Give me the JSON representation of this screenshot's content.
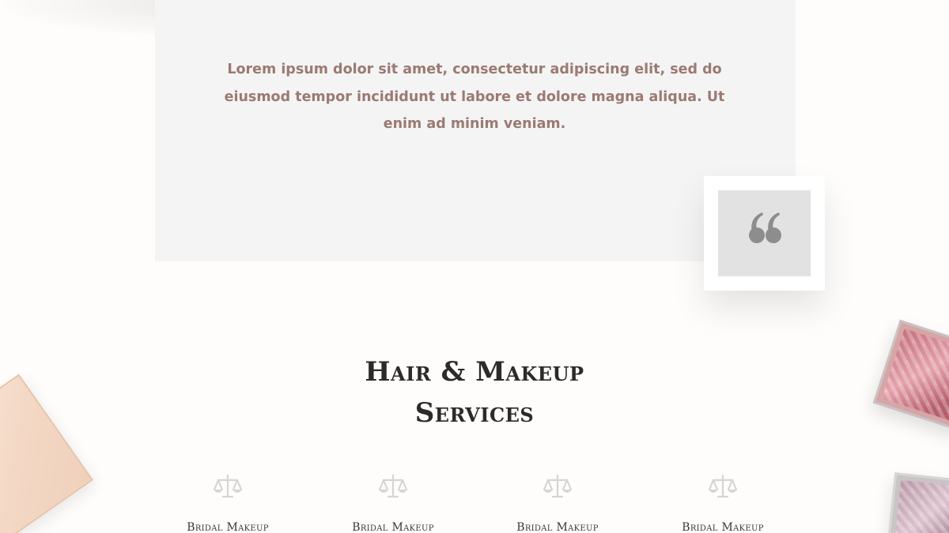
{
  "testimonial": {
    "text": "Lorem ipsum dolor sit amet, consectetur adipiscing elit, sed do eiusmod tempor incididunt ut labore et dolore magna aliqua. Ut enim ad minim veniam."
  },
  "quote_icon": "quote-icon",
  "services": {
    "title_line1": "Hair & Makeup",
    "title_line2": "Services",
    "items": [
      {
        "icon": "scale-icon",
        "label": "Bridal Makeup"
      },
      {
        "icon": "scale-icon",
        "label": "Bridal Makeup"
      },
      {
        "icon": "scale-icon",
        "label": "Bridal Makeup"
      },
      {
        "icon": "scale-icon",
        "label": "Bridal Makeup"
      }
    ]
  },
  "colors": {
    "accent_text": "#9a7a72",
    "card_bg": "#f5f4f4",
    "title": "#2d2a2a"
  }
}
